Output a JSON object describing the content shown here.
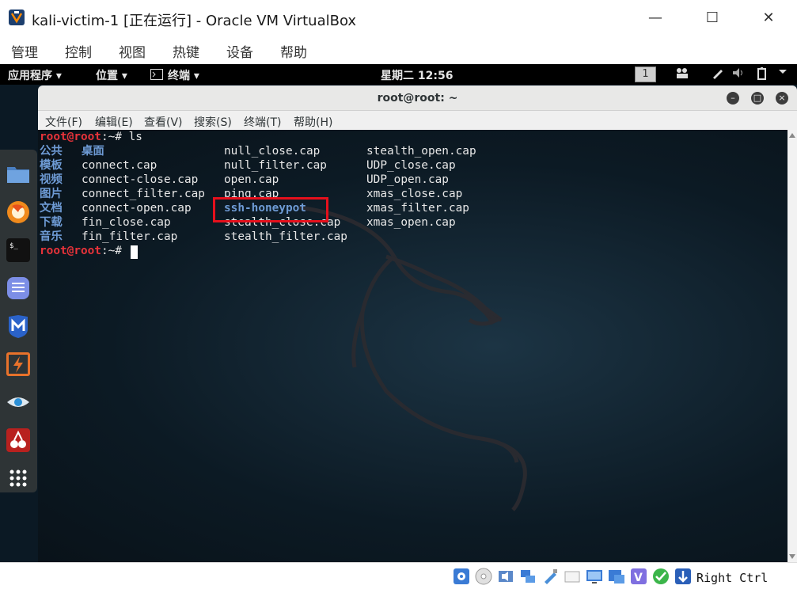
{
  "vbox": {
    "title": "kali-victim-1 [正在运行] - Oracle VM VirtualBox",
    "window_buttons": {
      "minimize": "—",
      "maximize": "☐",
      "close": "✕"
    },
    "menu": [
      "管理",
      "控制",
      "视图",
      "热键",
      "设备",
      "帮助"
    ],
    "status": {
      "host_key": "Right Ctrl"
    }
  },
  "gnome": {
    "applications": "应用程序 ▾",
    "places": "位置 ▾",
    "terminal_app": "终端 ▾",
    "clock": "星期二 12:56",
    "workspace": "1"
  },
  "terminal": {
    "title": "root@root: ~",
    "menu": [
      "文件(F)",
      "编辑(E)",
      "查看(V)",
      "搜索(S)",
      "终端(T)",
      "帮助(H)"
    ],
    "prompt_user": "root@root",
    "prompt_path": ":~# ",
    "command": "ls",
    "columns": [
      [
        "公共",
        "模板",
        "视频",
        "图片",
        "文档",
        "下载",
        "音乐"
      ],
      [
        "桌面",
        "connect.cap",
        "connect-close.cap",
        "connect_filter.cap",
        "connect-open.cap",
        "fin_close.cap",
        "fin_filter.cap"
      ],
      [
        "null_close.cap",
        "null_filter.cap",
        "open.cap",
        "ping.cap",
        "ssh-honeypot",
        "stealth_close.cap",
        "stealth_filter.cap"
      ],
      [
        "stealth_open.cap",
        "UDP_close.cap",
        "UDP_open.cap",
        "xmas_close.cap",
        "xmas_filter.cap",
        "xmas_open.cap"
      ]
    ],
    "directories": [
      "公共",
      "模板",
      "视频",
      "图片",
      "文档",
      "下载",
      "音乐",
      "桌面",
      "ssh-honeypot"
    ]
  },
  "colors": {
    "prompt": "#e8333a",
    "directory": "#6e9bd5",
    "highlight_box": "#e5101c"
  }
}
